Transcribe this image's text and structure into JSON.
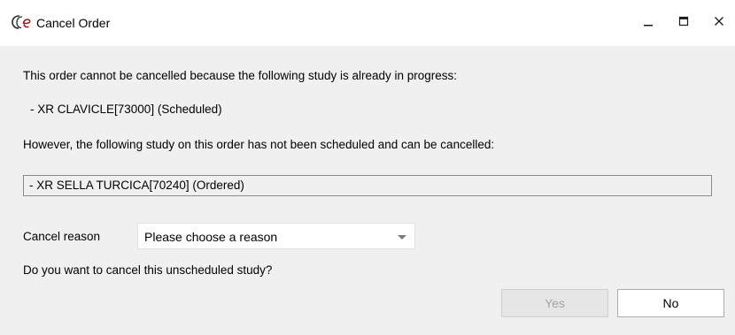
{
  "window": {
    "title": "Cancel Order",
    "app_icon": "ce-logo-icon",
    "controls": {
      "minimize_icon": "minimize-icon",
      "maximize_icon": "maximize-icon",
      "close_icon": "close-icon"
    }
  },
  "message": {
    "in_progress_text": "This order cannot be cancelled because the following study is already in progress:",
    "in_progress_study": "- XR CLAVICLE[73000] (Scheduled)",
    "cancellable_text": "However, the following study on this order has not been scheduled and can be cancelled:",
    "cancellable_study": "- XR SELLA TURCICA[70240] (Ordered)"
  },
  "reason": {
    "label": "Cancel reason",
    "selected": "Please choose a reason",
    "caret_icon": "chevron-down-icon"
  },
  "question": "Do you want to cancel this unscheduled study?",
  "buttons": {
    "yes_label": "Yes",
    "yes_enabled": false,
    "no_label": "No"
  },
  "colors": {
    "dialog_background": "#f0f0f0",
    "titlebar_background": "#ffffff",
    "logo_red": "#9b1c1c",
    "disabled_text": "#a3a3a3"
  }
}
